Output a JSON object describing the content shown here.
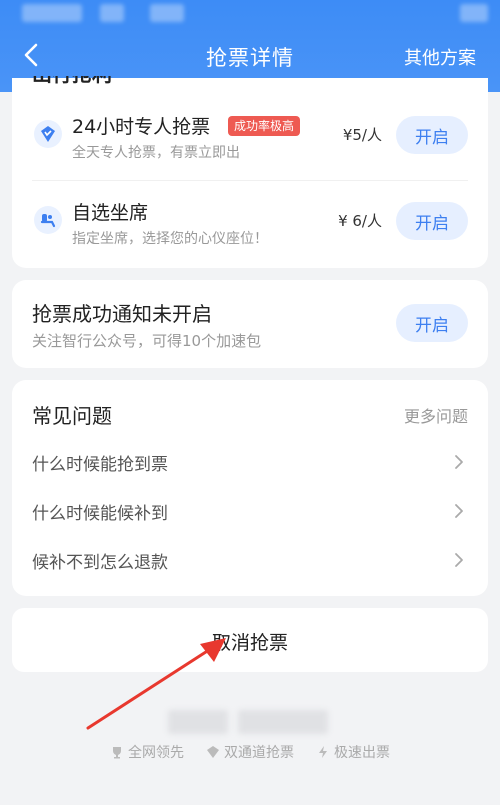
{
  "header": {
    "title": "抢票详情",
    "other_plan": "其他方案"
  },
  "services": {
    "partial_title": "出行抢利",
    "items": [
      {
        "title": "24小时专人抢票",
        "badge": "成功率极高",
        "desc": "全天专人抢票，有票立即出",
        "price": "¥5/人",
        "button": "开启",
        "icon": "diamond-icon"
      },
      {
        "title": "自选坐席",
        "badge": "",
        "desc": "指定坐席，选择您的心仪座位！",
        "price": "¥ 6/人",
        "button": "开启",
        "icon": "seat-icon"
      }
    ]
  },
  "notify": {
    "title": "抢票成功通知未开启",
    "desc": "关注智行公众号，可得10个加速包",
    "button": "开启"
  },
  "faq": {
    "title": "常见问题",
    "more": "更多问题",
    "items": [
      "什么时候能抢到票",
      "什么时候能候补到",
      "候补不到怎么退款"
    ]
  },
  "cancel": {
    "label": "取消抢票"
  },
  "features": [
    "全网领先",
    "双通道抢票",
    "极速出票"
  ],
  "colors": {
    "header_blue": "#3d8cf6",
    "button_text": "#3d7ff0",
    "button_bg": "#e6efff",
    "badge_red": "#ee5a52",
    "annotation_arrow": "#e8382e"
  }
}
